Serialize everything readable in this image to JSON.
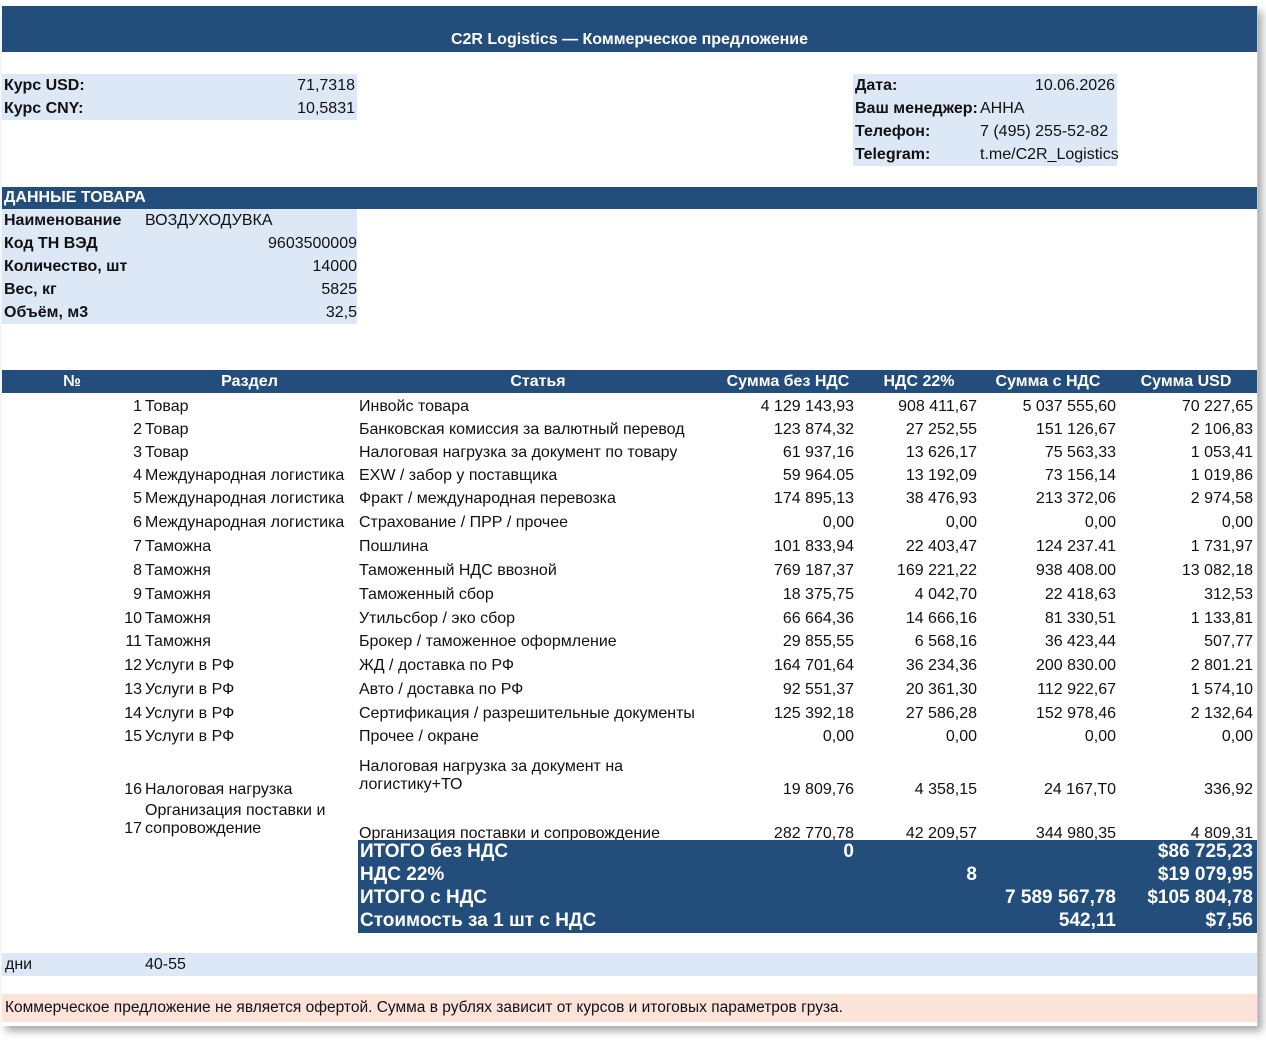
{
  "header": {
    "title": "C2R Logistics — Коммерческое предложение"
  },
  "rates": {
    "usd_label": "Курс USD:",
    "usd_value": "71,7318",
    "cny_label": "Курс CNY:",
    "cny_value": "10,5831"
  },
  "contact": {
    "date_label": "Дата:",
    "date_value": "10.06.2026",
    "manager_label": "Ваш менеджер:",
    "manager_value": "АННА",
    "phone_label": "Телефон:",
    "phone_value": "7 (495) 255-52-82",
    "telegram_label": "Telegram:",
    "telegram_value": "t.me/C2R_Logistics"
  },
  "product": {
    "section_title": "ДАННЫЕ ТОВАРА",
    "fields": [
      {
        "label": "Наименование",
        "value": "ВОЗДУХОДУВКА",
        "align": "left"
      },
      {
        "label": "Код ТН ВЭД",
        "value": "9603500009",
        "align": "right"
      },
      {
        "label": "Количество, шт",
        "value": "14000",
        "align": "right"
      },
      {
        "label": "Вес, кг",
        "value": "5825",
        "align": "right"
      },
      {
        "label": "Объём, м3",
        "value": "32,5",
        "align": "right"
      }
    ]
  },
  "table": {
    "columns": [
      "№",
      "Раздел",
      "Статья",
      "Сумма без НДС",
      "НДС 22%",
      "Сумма с НДС",
      "Сумма USD"
    ],
    "rows": [
      {
        "num": "1",
        "section": "Товар",
        "item": "Инвойс товара",
        "net": "4 129 143,93",
        "vat": "908 411,67",
        "gross": "5 037 555,60",
        "usd": "70 227,65"
      },
      {
        "num": "2",
        "section": "Товар",
        "item": "Банковская комиссия за валютный перевод",
        "net": "123 874,32",
        "vat": "27 252,55",
        "gross": "151 126,67",
        "usd": "2 106,83"
      },
      {
        "num": "3",
        "section": "Товар",
        "item": "Налоговая нагрузка за документ по товару",
        "net": "61 937,16",
        "vat": "13 626,17",
        "gross": "75 563,33",
        "usd": "1 053,41"
      },
      {
        "num": "4",
        "section": "Международная логистика",
        "item": "EXW / забор у поставщика",
        "net": "59 964.05",
        "vat": "13 192,09",
        "gross": "73 156,14",
        "usd": "1 019,86"
      },
      {
        "num": "5",
        "section": "Международная логистика",
        "item": "Фракт / международная перевозка",
        "net": "174 895,13",
        "vat": "38 476,93",
        "gross": "213 372,06",
        "usd": "2 974,58"
      },
      {
        "num": "6",
        "section": "Международная логистика",
        "item": "Страхование / ПРР / прочее",
        "net": "0,00",
        "vat": "0,00",
        "gross": "0,00",
        "usd": "0,00"
      },
      {
        "num": "7",
        "section": "Таможна",
        "item": "Пошлина",
        "net": "101 833,94",
        "vat": "22 403,47",
        "gross": "124 237.41",
        "usd": "1 731,97"
      },
      {
        "num": "8",
        "section": "Таможня",
        "item": "Таможенный НДС ввозной",
        "net": "769 187,37",
        "vat": "169 221,22",
        "gross": "938 408.00",
        "usd": "13 082,18"
      },
      {
        "num": "9",
        "section": "Таможня",
        "item": "Таможенный сбор",
        "net": "18 375,75",
        "vat": "4 042,70",
        "gross": "22 418,63",
        "usd": "312,53"
      },
      {
        "num": "10",
        "section": "Таможня",
        "item": "Утильсбор / эко сбор",
        "net": "66 664,36",
        "vat": "14 666,16",
        "gross": "81 330,51",
        "usd": "1 133,81"
      },
      {
        "num": "11",
        "section": "Таможня",
        "item": "Брокер / таможенное оформление",
        "net": "29 855,55",
        "vat": "6 568,16",
        "gross": "36 423,44",
        "usd": "507,77"
      },
      {
        "num": "12",
        "section": "Услуги в РФ",
        "item": "ЖД / доставка по РФ",
        "net": "164 701,64",
        "vat": "36 234,36",
        "gross": "200 830.00",
        "usd": "2 801.21"
      },
      {
        "num": "13",
        "section": "Услуги в РФ",
        "item": "Авто / доставка по РФ",
        "net": "92 551,37",
        "vat": "20 361,30",
        "gross": "112 922,67",
        "usd": "1 574,10"
      },
      {
        "num": "14",
        "section": "Услуги в РФ",
        "item": "Сертификация / разрешительные документы",
        "net": "125 392,18",
        "vat": "27 586,28",
        "gross": "152 978,46",
        "usd": "2 132,64"
      },
      {
        "num": "15",
        "section": "Услуги в РФ",
        "item": "Прочее / окране",
        "net": "0,00",
        "vat": "0,00",
        "gross": "0,00",
        "usd": "0,00"
      }
    ],
    "row16": {
      "num": "16",
      "section": "Налоговая нагрузка",
      "item_line1": "Налоговая нагрузка за документ на",
      "item_line2": "логистику+ТО",
      "net": "19 809,76",
      "vat": "4 358,15",
      "gross": "24 167,Т0",
      "usd": "336,92"
    },
    "row17": {
      "num": "17",
      "section_line1": "Организация поставки и",
      "section_line2": "сопровождение",
      "item": "Организация поставки и сопровождение",
      "net": "282 770,78",
      "vat": "42 209,57",
      "gross": "344 980,35",
      "usd": "4 809,31"
    }
  },
  "totals": {
    "net_label": "ИТОГО без НДС",
    "net_value": "0",
    "net_usd": "$86 725,23",
    "vat_label": "НДС 22%",
    "vat_value": "8",
    "vat_usd": "$19 079,95",
    "gross_label": "ИТОГО с НДС",
    "gross_value": "7 589 567,78",
    "gross_usd": "$105 804,78",
    "unit_label": "Стоимость за 1 шт с НДС",
    "unit_value": "542,11",
    "unit_usd": "$7,56"
  },
  "days": {
    "label": "дни",
    "value": "40-55"
  },
  "footer": {
    "note": "Коммерческое предложение не является офертой. Сумма в рублях зависит от курсов и итоговых параметров груза."
  }
}
